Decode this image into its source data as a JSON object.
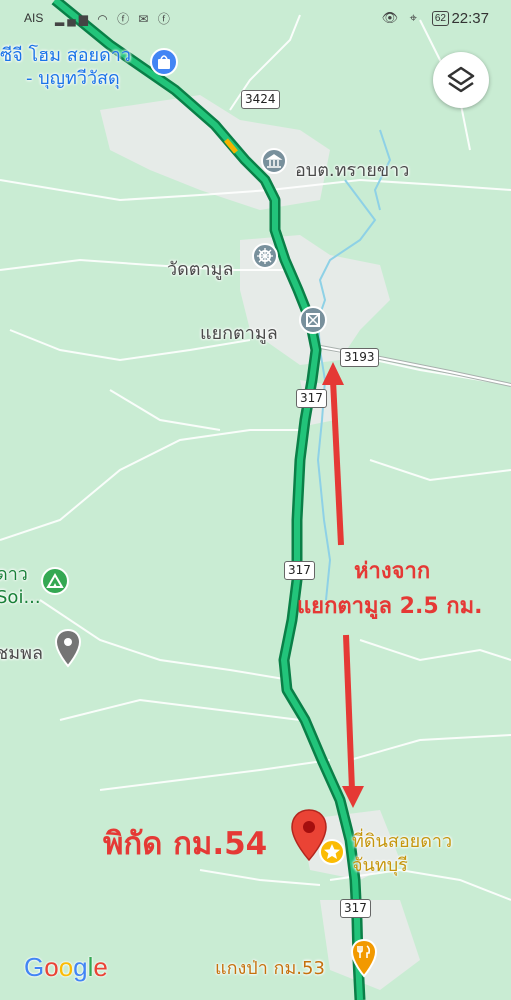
{
  "status_bar": {
    "carrier": "AIS",
    "battery": "62",
    "time": "22:37"
  },
  "labels": {
    "store_line1": "ซีจี โฮม สอยดาว",
    "store_line2": "- บุญทวีวัสดุ",
    "office": "อบต.ทรายขาว",
    "temple": "วัดตามูล",
    "intersection": "แยกตามูล",
    "camp_line1": "ดาว",
    "camp_line2": "Soi...",
    "place_left": "ชมพล",
    "land_line1": "ที่ดินสอยดาว",
    "land_line2": "จันทบุรี",
    "restaurant": "แกงป่า กม.53"
  },
  "road_shields": {
    "r3424": "3424",
    "r3193": "3193",
    "r317_a": "317",
    "r317_b": "317",
    "r317_c": "317"
  },
  "annotations": {
    "distance_line1": "ห่างจาก",
    "distance_line2": "แยกตามูล 2.5 กม.",
    "coordinates": "พิกัด กม.54"
  },
  "brand": {
    "logo": [
      "G",
      "o",
      "o",
      "g",
      "l",
      "e"
    ],
    "logo_colors": [
      "#4285F4",
      "#EA4335",
      "#FBBC05",
      "#4285F4",
      "#34A853",
      "#EA4335"
    ]
  },
  "colors": {
    "map_bg": "#c9ecd3",
    "route": "#0f9d58",
    "annotation": "#e53935",
    "pin": "#ea4335"
  },
  "icons": [
    "shopping-bag-icon",
    "layers-icon",
    "government-icon",
    "temple-icon",
    "landmark-icon",
    "campground-icon",
    "location-icon",
    "red-pin-icon",
    "star-icon",
    "restaurant-icon"
  ]
}
